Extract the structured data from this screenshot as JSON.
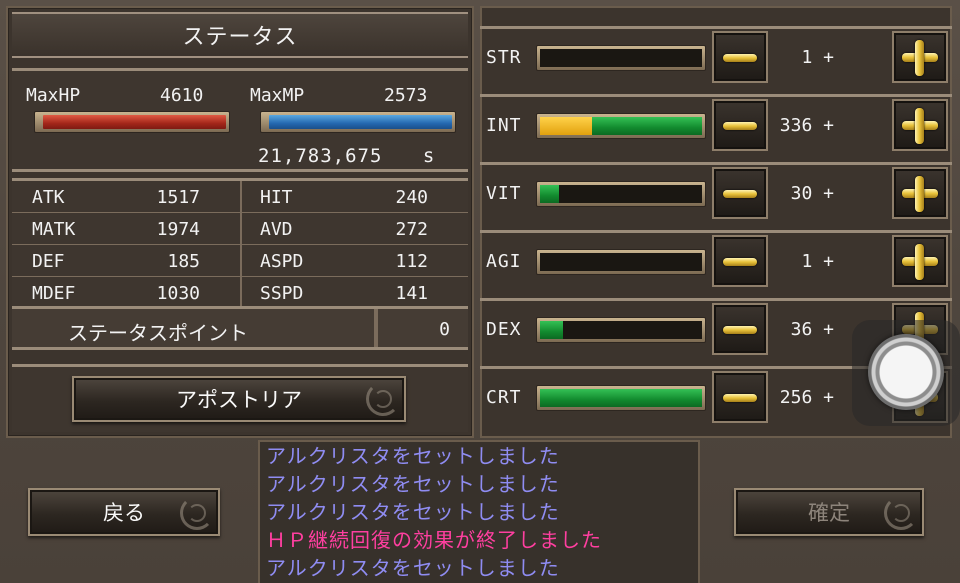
{
  "status_panel": {
    "title": "ステータス",
    "max_hp_label": "MaxHP",
    "max_hp_value": "4610",
    "max_mp_label": "MaxMP",
    "max_mp_value": "2573",
    "hp_fill": 1.0,
    "mp_fill": 1.0,
    "hp_color": "#a3261a",
    "mp_color": "#2468b0",
    "gold_value": "21,783,675",
    "gold_unit": "s",
    "stats_left": [
      {
        "label": "ATK",
        "value": "1517"
      },
      {
        "label": "MATK",
        "value": "1974"
      },
      {
        "label": "DEF",
        "value": "185"
      },
      {
        "label": "MDEF",
        "value": "1030"
      }
    ],
    "stats_right": [
      {
        "label": "HIT",
        "value": "240"
      },
      {
        "label": "AVD",
        "value": "272"
      },
      {
        "label": "ASPD",
        "value": "112"
      },
      {
        "label": "SSPD",
        "value": "141"
      }
    ],
    "status_points_label": "ステータスポイント",
    "status_points_value": "0",
    "apostoria_button": "アポストリア"
  },
  "params": [
    {
      "name": "STR",
      "value": "1",
      "plus": "+",
      "yellow": 0.0,
      "green": 0.0
    },
    {
      "name": "INT",
      "value": "336",
      "plus": "+",
      "yellow": 0.32,
      "green": 0.68
    },
    {
      "name": "VIT",
      "value": "30",
      "plus": "+",
      "yellow": 0.0,
      "green": 0.12
    },
    {
      "name": "AGI",
      "value": "1",
      "plus": "+",
      "yellow": 0.0,
      "green": 0.0
    },
    {
      "name": "DEX",
      "value": "36",
      "plus": "+",
      "yellow": 0.0,
      "green": 0.14
    },
    {
      "name": "CRT",
      "value": "256",
      "plus": "+",
      "yellow": 0.0,
      "green": 1.0
    }
  ],
  "footer": {
    "back_button": "戻る",
    "confirm_button": "確定"
  },
  "log": [
    {
      "text": "アルクリスタをセットしました",
      "type": "normal"
    },
    {
      "text": "アルクリスタをセットしました",
      "type": "normal"
    },
    {
      "text": "アルクリスタをセットしました",
      "type": "normal"
    },
    {
      "text": "ＨＰ継続回復の効果が終了しました",
      "type": "alert"
    },
    {
      "text": "アルクリスタをセットしました",
      "type": "normal"
    }
  ],
  "colors": {
    "log_normal": "#8f8cf2",
    "log_alert": "#ff3fa0",
    "bar_yellow": "#e2a10e",
    "bar_green": "#128a2e",
    "button_icon_gold": "#e8c23a"
  }
}
